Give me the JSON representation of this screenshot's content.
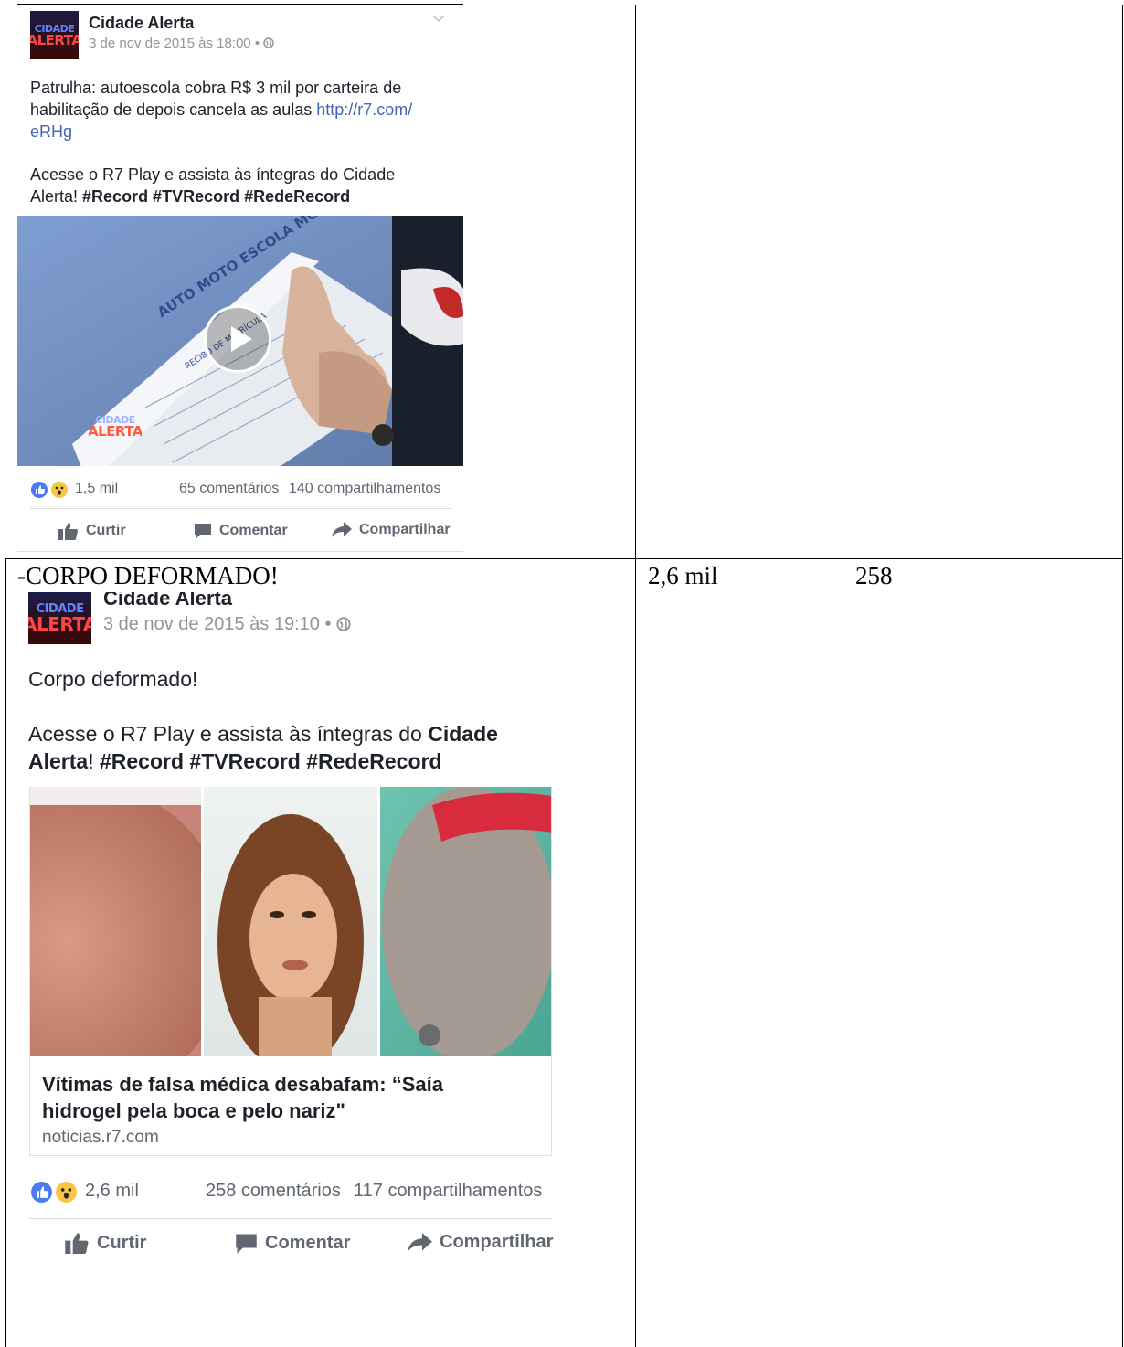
{
  "row1": {
    "post": {
      "page_name": "Cidade Alerta",
      "timestamp": "3 de nov de 2015 às 18:00",
      "dot": "•",
      "text_line1": "Patrulha: autoescola cobra R$ 3 mil por carteira de",
      "text_line2_a": "habilitação de depois cancela as aulas ",
      "link_part1": "http://r7.com/",
      "link_part2": "eRHg",
      "promo_line1": "Acesse o R7 Play e assista às íntegras do Cidade",
      "promo_line2_a": "Alerta! ",
      "hashtags": "#Record #TVRecord #RedeRecord",
      "video": {
        "paper_title": "AUTO MOTO ESCOLA MG",
        "paper_sub": "RECIBO DE MATRÍCULA",
        "overlay_logo_top": "CIDADE",
        "overlay_logo_bottom": "ALERTA"
      },
      "reactions_count": "1,5 mil",
      "comments": "65 comentários",
      "shares": "140 compartilhamentos",
      "actions": {
        "like": "Curtir",
        "comment": "Comentar",
        "share": "Compartilhar"
      }
    },
    "col2": "",
    "col3": ""
  },
  "row2": {
    "caption": "-CORPO DEFORMADO!",
    "col2": "2,6 mil",
    "col3": "258",
    "post": {
      "page_name": "Cidade Alerta",
      "timestamp": "3 de nov de 2015 às 19:10",
      "dot": "•",
      "text": "Corpo deformado!",
      "promo_line1_a": "Acesse o R7 Play e assista às íntegras do ",
      "promo_line1_b": "Cidade",
      "promo_line2_a": "Alerta",
      "promo_line2_b": "! ",
      "hashtags": "#Record #TVRecord #RedeRecord",
      "link_title_line1": "Vítimas de falsa médica desabafam: “Saía",
      "link_title_line2": "hidrogel pela boca e pelo nariz\"",
      "link_domain": "noticias.r7.com",
      "reactions_count": "2,6 mil",
      "comments": "258 comentários",
      "shares": "117 compartilhamentos",
      "actions": {
        "like": "Curtir",
        "comment": "Comentar",
        "share": "Compartilhar"
      }
    }
  },
  "logo": {
    "top": "CIDADE",
    "bottom": "ALERTA"
  },
  "colors": {
    "link": "#4267b2",
    "like_blue": "#4b7cf2",
    "wow_yellow": "#f7c644",
    "muted": "#606770"
  }
}
